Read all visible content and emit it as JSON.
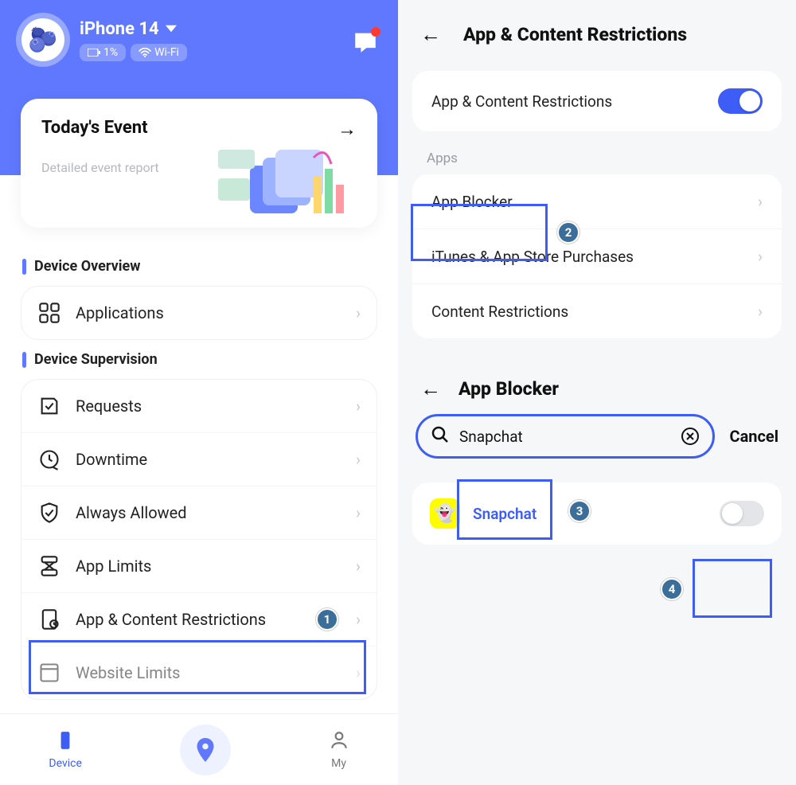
{
  "left": {
    "profile": {
      "device_name": "iPhone 14",
      "battery": "1%",
      "wifi": "Wi-Fi",
      "avatar_emoji": "🫐"
    },
    "today": {
      "title": "Today's Event",
      "subtitle": "Detailed event report"
    },
    "overview_header": "Device Overview",
    "overview_rows": [
      {
        "label": "Applications"
      }
    ],
    "supervision_header": "Device Supervision",
    "supervision_rows": [
      {
        "label": "Requests"
      },
      {
        "label": "Downtime"
      },
      {
        "label": "Always Allowed"
      },
      {
        "label": "App Limits"
      },
      {
        "label": "App & Content Restrictions"
      },
      {
        "label": "Website Limits"
      }
    ],
    "nav": {
      "device": "Device",
      "my": "My"
    },
    "step1": "1"
  },
  "right": {
    "title": "App & Content Restrictions",
    "master_toggle_label": "App & Content Restrictions",
    "section_apps": "Apps",
    "apps_rows": [
      {
        "label": "App Blocker"
      },
      {
        "label": "iTunes & App Store Purchases"
      },
      {
        "label": "Content Restrictions"
      }
    ],
    "step2": "2",
    "sub_title": "App Blocker",
    "search_value": "Snapchat",
    "cancel": "Cancel",
    "step3": "3",
    "result_app": "Snapchat",
    "step4": "4"
  }
}
